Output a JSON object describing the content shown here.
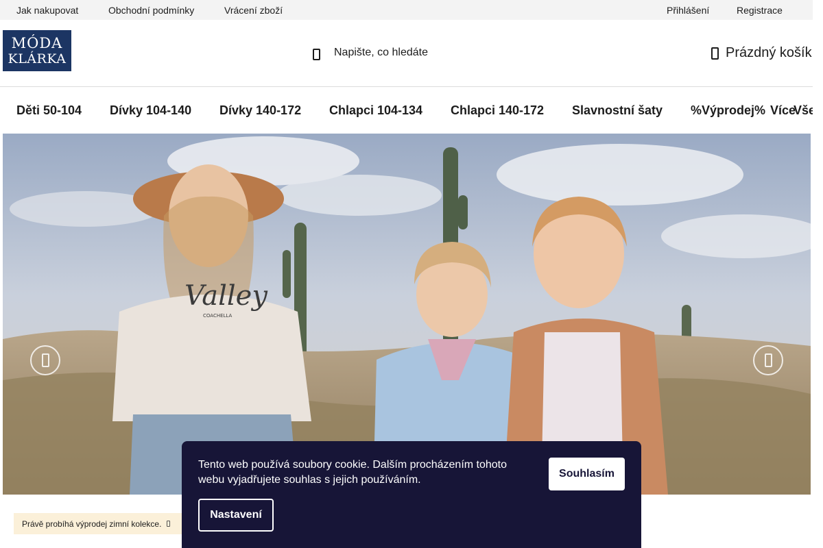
{
  "topbar": {
    "links": [
      "Jak nakupovat",
      "Obchodní podmínky",
      "Vrácení zboží"
    ],
    "login": "Přihlášení",
    "register": "Registrace"
  },
  "header": {
    "logo_line1": "MÓDA",
    "logo_line2": "KLÁRKA",
    "search_placeholder": "Napište, co hledáte",
    "cart_label": "Prázdný košík",
    "icons": {
      "search": "search-icon",
      "cart": "cart-icon"
    }
  },
  "nav": {
    "items": [
      "Děti 50-104",
      "Dívky 104-140",
      "Dívky 140-172",
      "Chlapci 104-134",
      "Chlapci 140-172",
      "Slavnostní šaty",
      "%Výprodej%",
      "Více",
      "Vše"
    ]
  },
  "hero": {
    "sweatshirt_text": "Valley",
    "sweatshirt_subtext": "COACHELLA",
    "icons": {
      "prev": "chevron-left-icon",
      "next": "chevron-right-icon"
    }
  },
  "notice": {
    "text": "Právě probíhá výprodej zimní kolekce."
  },
  "cookie": {
    "text": "Tento web používá soubory cookie. Dalším procházením tohoto webu vyjadřujete souhlas s jejich používáním.",
    "agree_label": "Souhlasím",
    "settings_label": "Nastavení"
  },
  "colors": {
    "brand": "#1c3563",
    "topbar_bg": "#f3f3f3",
    "cookie_bg": "#171537",
    "notice_bg": "#fbf0d9"
  }
}
